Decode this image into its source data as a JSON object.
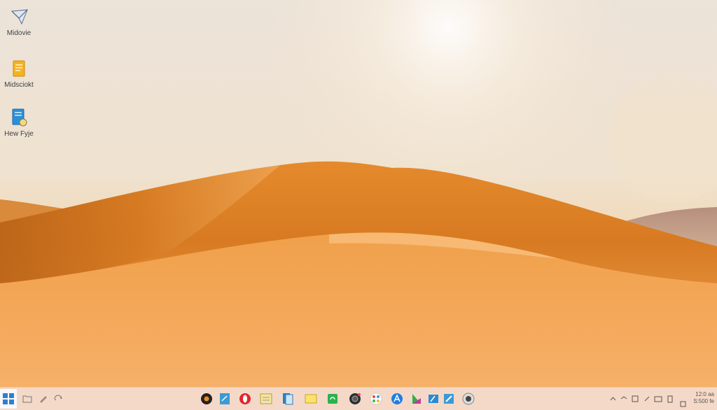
{
  "desktop": {
    "icons": [
      {
        "label": "Midovie",
        "icon": "mail-send-icon"
      },
      {
        "label": "Midsciokt",
        "icon": "document-folder-icon"
      },
      {
        "label": "Hew Fyje",
        "icon": "file-document-icon"
      }
    ]
  },
  "taskbar": {
    "start": "windows-start-icon",
    "left_icons": [
      "folder-icon",
      "pen-icon",
      "recycle-icon"
    ],
    "pinned_apps": [
      "media-player-icon",
      "files-icon",
      "opera-browser-icon",
      "notes-icon",
      "documents-icon",
      "sticky-notes-icon",
      "recycle-app-icon",
      "camera-lens-icon",
      "photos-icon",
      "app-store-icon",
      "color-app-icon",
      "paint-app-icon",
      "editor-icon",
      "webcam-icon"
    ],
    "tray": {
      "time": "12:0 aa",
      "date": "S:500 fe"
    }
  },
  "colors": {
    "taskbar_bg": "#f5d9c8",
    "dune_light": "#f2a957",
    "dune_dark": "#c8701f",
    "start_accent": "#2f7fd0"
  }
}
